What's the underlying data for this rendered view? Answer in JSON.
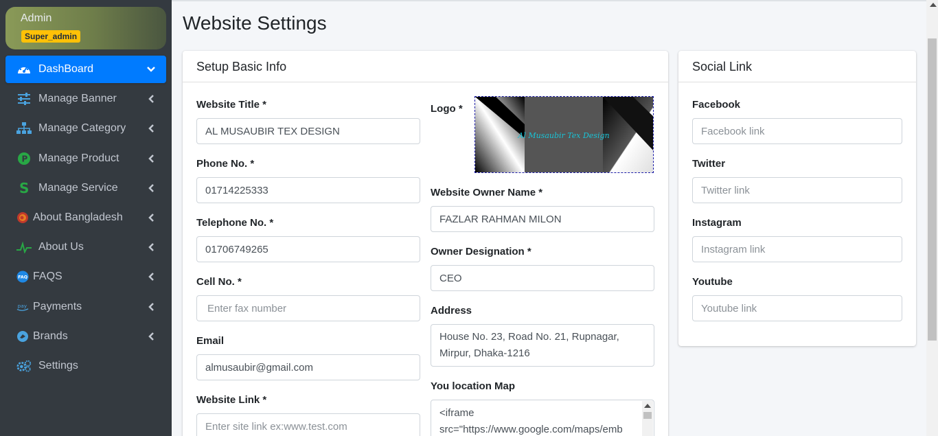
{
  "user": {
    "name": "Admin",
    "role": "Super_admin"
  },
  "sidebar": {
    "items": [
      {
        "label": "DashBoard",
        "icon": "dashboard-gauge-icon",
        "active": true
      },
      {
        "label": "Manage Banner",
        "icon": "sliders-icon"
      },
      {
        "label": "Manage Category",
        "icon": "sitemap-icon"
      },
      {
        "label": "Manage Product",
        "icon": "product-p-icon"
      },
      {
        "label": "Manage Service",
        "icon": "service-s-icon"
      },
      {
        "label": "About Bangladesh",
        "icon": "bangladesh-flag-icon"
      },
      {
        "label": "About Us",
        "icon": "pulse-icon"
      },
      {
        "label": "FAQS",
        "icon": "faq-icon"
      },
      {
        "label": "Payments",
        "icon": "pay-icon"
      },
      {
        "label": "Brands",
        "icon": "brand-icon"
      },
      {
        "label": "Settings",
        "icon": "gears-icon"
      }
    ]
  },
  "page": {
    "title": "Website Settings"
  },
  "basic_info": {
    "header": "Setup Basic Info",
    "website_title": {
      "label": "Website Title *",
      "value": "AL MUSAUBIR TEX DESIGN"
    },
    "phone": {
      "label": "Phone No. *",
      "value": "01714225333"
    },
    "telephone": {
      "label": "Telephone No. *",
      "value": "01706749265"
    },
    "cell": {
      "label": "Cell No. *",
      "placeholder": "Enter fax number"
    },
    "email": {
      "label": "Email",
      "value": "almusaubir@gmail.com"
    },
    "website_link": {
      "label": "Website Link *",
      "placeholder": "Enter site link ex:www.test.com"
    },
    "logo": {
      "label": "Logo *",
      "text": "Al Musaubir Tex Design"
    },
    "owner_name": {
      "label": "Website Owner Name *",
      "value": "FAZLAR RAHMAN MILON"
    },
    "owner_designation": {
      "label": "Owner Designation *",
      "value": "CEO"
    },
    "address": {
      "label": "Address",
      "value": "House No. 23, Road No. 21, Rupnagar, Mirpur, Dhaka-1216"
    },
    "map": {
      "label": "You location Map",
      "value": "<iframe src=\"https://www.google.com/maps/emb"
    }
  },
  "social": {
    "header": "Social Link",
    "facebook": {
      "label": "Facebook",
      "placeholder": "Facebook link"
    },
    "twitter": {
      "label": "Twitter",
      "placeholder": "Twitter link"
    },
    "instagram": {
      "label": "Instagram",
      "placeholder": "Instagram link"
    },
    "youtube": {
      "label": "Youtube",
      "placeholder": "Youtube link"
    }
  },
  "colors": {
    "sidebar_bg": "#343a40",
    "active": "#007bff",
    "badge": "#ffc107",
    "logo_text": "#19c3d6"
  }
}
